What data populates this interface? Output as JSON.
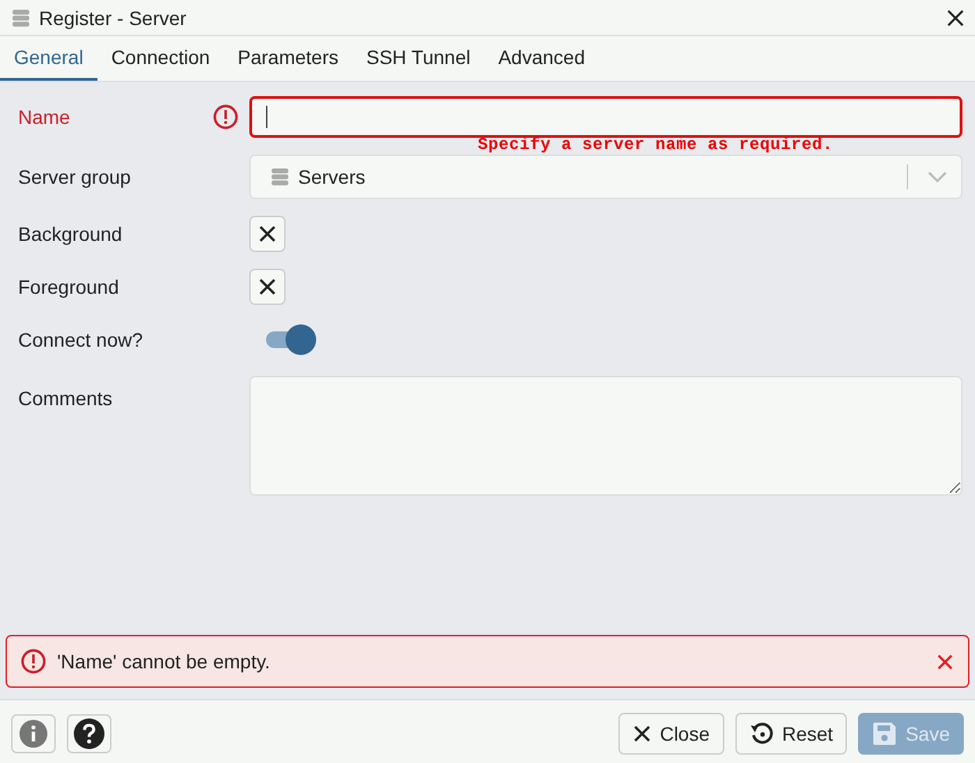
{
  "window": {
    "title": "Register - Server"
  },
  "tabs": [
    {
      "label": "General",
      "selected": true
    },
    {
      "label": "Connection",
      "selected": false
    },
    {
      "label": "Parameters",
      "selected": false
    },
    {
      "label": "SSH Tunnel",
      "selected": false
    },
    {
      "label": "Advanced",
      "selected": false
    }
  ],
  "fields": [
    {
      "kind": "text",
      "label": "Name",
      "invalid": true
    },
    {
      "kind": "select",
      "label": "Server group",
      "value": "Servers"
    },
    {
      "kind": "color",
      "label": "Background"
    },
    {
      "kind": "color",
      "label": "Foreground"
    },
    {
      "kind": "switch",
      "label": "Connect now?",
      "on": true
    },
    {
      "kind": "textarea",
      "label": "Comments"
    }
  ],
  "annotation": "Specify a server name as required.",
  "error_message": "'Name' cannot be empty.",
  "buttons": [
    {
      "kind": "close",
      "label": "Close",
      "disabled": false
    },
    {
      "kind": "reset",
      "label": "Reset",
      "disabled": false
    },
    {
      "kind": "save",
      "label": "Save",
      "disabled": true
    }
  ]
}
